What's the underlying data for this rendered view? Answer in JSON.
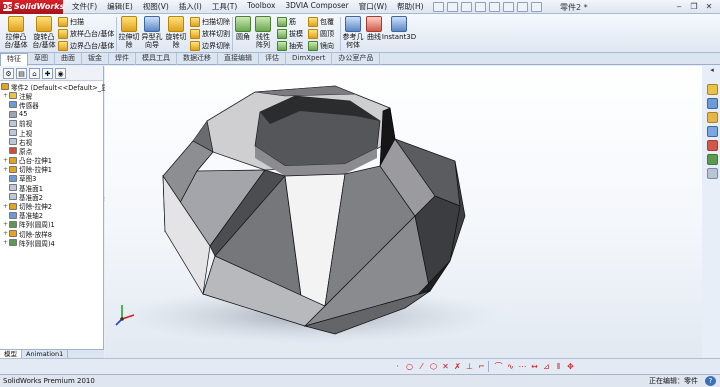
{
  "app": {
    "logo": "SolidWorks",
    "document_title": "零件2 *"
  },
  "menu": [
    "文件(F)",
    "编辑(E)",
    "视图(V)",
    "插入(I)",
    "工具(T)",
    "Toolbox",
    "3DVIA Composer",
    "窗口(W)",
    "帮助(H)"
  ],
  "ribbon": {
    "extrude_boss": "拉伸凸台/基体",
    "revolve_boss": "旋转凸台/基体",
    "sweep": "扫描",
    "loft": "放样凸台/基体",
    "boundary_boss": "边界凸台/基体",
    "extrude_cut": "拉伸切除",
    "hole_wizard": "异型孔向导",
    "revolve_cut": "旋转切除",
    "swept_cut": "扫描切除",
    "lofted_cut": "放样切割",
    "boundary_cut": "边界切除",
    "fillet": "圆角",
    "linear_pattern": "线性阵列",
    "rib": "筋",
    "draft": "拔模",
    "shell": "抽壳",
    "wrap": "包覆",
    "dome": "圆顶",
    "mirror": "镜向",
    "reference_geometry": "参考几何体",
    "curves": "曲线",
    "instant3d": "Instant3D"
  },
  "tabs": [
    "特征",
    "草图",
    "曲面",
    "钣金",
    "焊件",
    "模具工具",
    "数据迁移",
    "直接编辑",
    "评估",
    "DimXpert",
    "办公室产品"
  ],
  "tree": [
    {
      "label": "零件2  (Default<<Default>_显",
      "icon": "part",
      "exp": ""
    },
    {
      "label": "注解",
      "icon": "annot",
      "exp": "+"
    },
    {
      "label": "传感器",
      "icon": "sensor",
      "exp": ""
    },
    {
      "label": "45",
      "icon": "material",
      "exp": ""
    },
    {
      "label": "前视",
      "icon": "plane",
      "exp": ""
    },
    {
      "label": "上视",
      "icon": "plane",
      "exp": ""
    },
    {
      "label": "右视",
      "icon": "plane",
      "exp": ""
    },
    {
      "label": "原点",
      "icon": "origin",
      "exp": ""
    },
    {
      "label": "凸台-拉伸1",
      "icon": "boss",
      "exp": "+"
    },
    {
      "label": "切除-拉伸1",
      "icon": "cut",
      "exp": "+"
    },
    {
      "label": "草图3",
      "icon": "sketch",
      "exp": ""
    },
    {
      "label": "基准面1",
      "icon": "plane",
      "exp": ""
    },
    {
      "label": "基准面2",
      "icon": "plane",
      "exp": ""
    },
    {
      "label": "切除-拉伸2",
      "icon": "cut",
      "exp": "+"
    },
    {
      "label": "基准轴2",
      "icon": "axis",
      "exp": ""
    },
    {
      "label": "阵列(圆周)1",
      "icon": "pattern",
      "exp": "+"
    },
    {
      "label": "切除-放样8",
      "icon": "cut",
      "exp": "+"
    },
    {
      "label": "阵列(圆周)4",
      "icon": "pattern",
      "exp": "+"
    }
  ],
  "bottom_tabs": [
    "模型",
    "Animation1"
  ],
  "status": {
    "left": "SolidWorks Premium 2010",
    "right": "正在编辑：零件",
    "help": "?"
  },
  "colors": {
    "accent_red": "#c81f25",
    "face_light": "#f2f2f2",
    "face_dark": "#2a2a2a"
  }
}
